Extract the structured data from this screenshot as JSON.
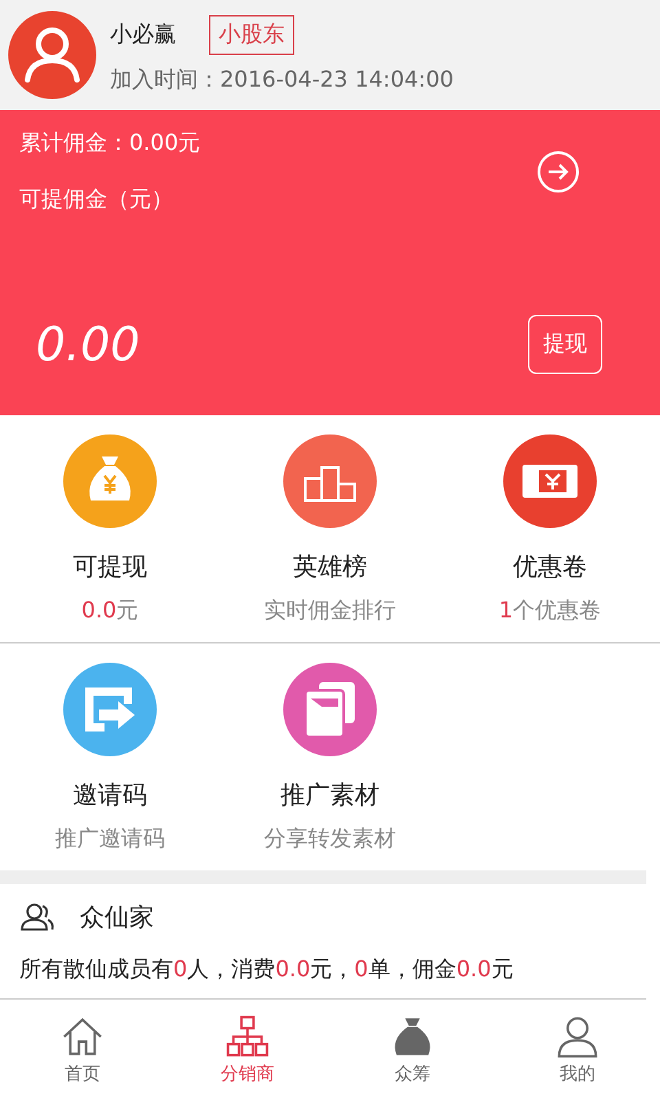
{
  "profile": {
    "name": "小必赢",
    "badge": "小股东",
    "join_time": "加入时间：2016-04-23 14:04:00"
  },
  "commission": {
    "total": "累计佣金：0.00元",
    "withdrawable_label": "可提佣金（元）",
    "amount": "0.00",
    "withdraw_button": "提现"
  },
  "grid": [
    {
      "kind": "money-bag",
      "title": "可提现",
      "subtitle": [
        {
          "text": "0.0",
          "highlight": true
        },
        {
          "text": "元",
          "highlight": false
        }
      ]
    },
    {
      "kind": "podium",
      "title": "英雄榜",
      "subtitle": [
        {
          "text": "实时佣金排行",
          "highlight": false
        }
      ]
    },
    {
      "kind": "coupon",
      "title": "优惠卷",
      "subtitle": [
        {
          "text": "1",
          "highlight": true
        },
        {
          "text": "个优惠卷",
          "highlight": false
        }
      ]
    },
    {
      "kind": "share",
      "title": "邀请码",
      "subtitle": [
        {
          "text": "推广邀请码",
          "highlight": false
        }
      ]
    },
    {
      "kind": "material",
      "title": "推广素材",
      "subtitle": [
        {
          "text": "分享转发素材",
          "highlight": false
        }
      ]
    }
  ],
  "team": {
    "title": "众仙家",
    "summary": [
      {
        "text": "所有散仙成员有",
        "highlight": false
      },
      {
        "text": "0",
        "highlight": true
      },
      {
        "text": "人，消费",
        "highlight": false
      },
      {
        "text": "0.0",
        "highlight": true
      },
      {
        "text": "元，",
        "highlight": false
      },
      {
        "text": "0",
        "highlight": true
      },
      {
        "text": "单，佣金",
        "highlight": false
      },
      {
        "text": "0.0",
        "highlight": true
      },
      {
        "text": "元",
        "highlight": false
      }
    ]
  },
  "tabs": [
    {
      "kind": "home",
      "label": "首页",
      "selected": false
    },
    {
      "kind": "tree",
      "label": "分销商",
      "selected": true
    },
    {
      "kind": "bag",
      "label": "众筹",
      "selected": false
    },
    {
      "kind": "person",
      "label": "我的",
      "selected": false
    }
  ]
}
